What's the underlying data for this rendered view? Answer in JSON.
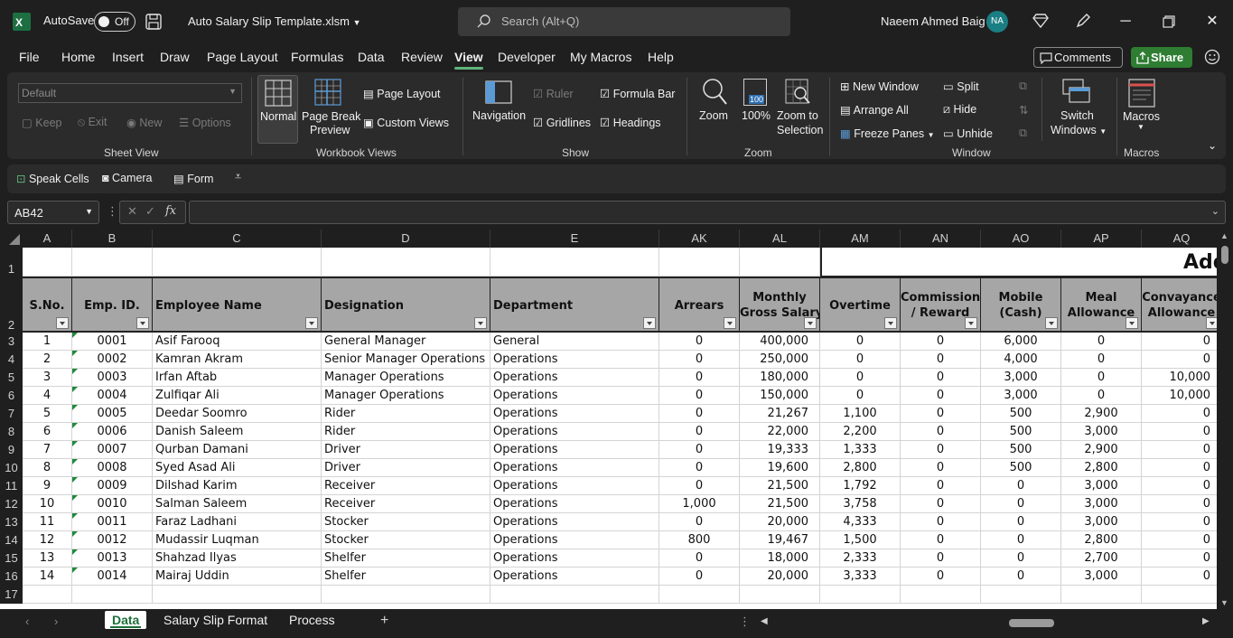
{
  "titlebar": {
    "autosave_label": "AutoSave",
    "autosave_state": "Off",
    "filename": "Auto Salary Slip Template.xlsm",
    "search_placeholder": "Search (Alt+Q)",
    "user_name": "Naeem Ahmed Baig",
    "user_initials": "NA"
  },
  "menu": {
    "items": [
      "File",
      "Home",
      "Insert",
      "Draw",
      "Page Layout",
      "Formulas",
      "Data",
      "Review",
      "View",
      "Developer",
      "My Macros",
      "Help"
    ],
    "active": "View",
    "comments_label": "Comments",
    "share_label": "Share"
  },
  "ribbon": {
    "sheet_view": {
      "dropdown_value": "Default",
      "keep": "Keep",
      "exit": "Exit",
      "new": "New",
      "options": "Options",
      "label": "Sheet View"
    },
    "workbook_views": {
      "normal": "Normal",
      "page_break_1": "Page Break",
      "page_break_2": "Preview",
      "page_layout": "Page Layout",
      "custom_views": "Custom Views",
      "label": "Workbook Views"
    },
    "show": {
      "navigation": "Navigation",
      "ruler": "Ruler",
      "gridlines": "Gridlines",
      "formula_bar": "Formula Bar",
      "headings": "Headings",
      "label": "Show"
    },
    "zoom": {
      "zoom": "Zoom",
      "hundred": "100%",
      "hundred_icon": "100",
      "zoom_sel_1": "Zoom to",
      "zoom_sel_2": "Selection",
      "label": "Zoom"
    },
    "window": {
      "new_window": "New Window",
      "arrange_all": "Arrange All",
      "freeze_panes": "Freeze Panes",
      "split": "Split",
      "hide": "Hide",
      "unhide": "Unhide",
      "switch_1": "Switch",
      "switch_2": "Windows",
      "label": "Window"
    },
    "macros": {
      "macros": "Macros",
      "label": "Macros"
    }
  },
  "qat": {
    "speak_cells": "Speak Cells",
    "camera": "Camera",
    "form": "Form"
  },
  "formula_bar": {
    "name_box": "AB42",
    "fx": "fx",
    "formula": ""
  },
  "sheet": {
    "columns": [
      "A",
      "B",
      "C",
      "D",
      "E",
      "AK",
      "AL",
      "AM",
      "AN",
      "AO",
      "AP",
      "AQ"
    ],
    "row1_title": "Add",
    "headers": [
      [
        "S.No."
      ],
      [
        "Emp. ID."
      ],
      [
        "Employee Name"
      ],
      [
        "Designation"
      ],
      [
        "Department"
      ],
      [
        "Arrears"
      ],
      [
        "Monthly",
        "Gross Salary"
      ],
      [
        "Overtime"
      ],
      [
        "Commission",
        "/ Reward"
      ],
      [
        "Mobile",
        "(Cash)"
      ],
      [
        "Meal",
        "Allowance"
      ],
      [
        "Convayance",
        "Allowance"
      ]
    ],
    "rows": [
      [
        "1",
        "0001",
        "Asif Farooq",
        "General Manager",
        "General",
        "0",
        "400,000",
        "0",
        "0",
        "6,000",
        "0",
        "0"
      ],
      [
        "2",
        "0002",
        "Kamran Akram",
        "Senior Manager Operations",
        "Operations",
        "0",
        "250,000",
        "0",
        "0",
        "4,000",
        "0",
        "0"
      ],
      [
        "3",
        "0003",
        "Irfan Aftab",
        "Manager Operations",
        "Operations",
        "0",
        "180,000",
        "0",
        "0",
        "3,000",
        "0",
        "10,000"
      ],
      [
        "4",
        "0004",
        "Zulfiqar Ali",
        "Manager Operations",
        "Operations",
        "0",
        "150,000",
        "0",
        "0",
        "3,000",
        "0",
        "10,000"
      ],
      [
        "5",
        "0005",
        "Deedar Soomro",
        "Rider",
        "Operations",
        "0",
        "21,267",
        "1,100",
        "0",
        "500",
        "2,900",
        "0"
      ],
      [
        "6",
        "0006",
        "Danish Saleem",
        "Rider",
        "Operations",
        "0",
        "22,000",
        "2,200",
        "0",
        "500",
        "3,000",
        "0"
      ],
      [
        "7",
        "0007",
        "Qurban Damani",
        "Driver",
        "Operations",
        "0",
        "19,333",
        "1,333",
        "0",
        "500",
        "2,900",
        "0"
      ],
      [
        "8",
        "0008",
        "Syed Asad Ali",
        "Driver",
        "Operations",
        "0",
        "19,600",
        "2,800",
        "0",
        "500",
        "2,800",
        "0"
      ],
      [
        "9",
        "0009",
        "Dilshad Karim",
        "Receiver",
        "Operations",
        "0",
        "21,500",
        "1,792",
        "0",
        "0",
        "3,000",
        "0"
      ],
      [
        "10",
        "0010",
        "Salman Saleem",
        "Receiver",
        "Operations",
        "1,000",
        "21,500",
        "3,758",
        "0",
        "0",
        "3,000",
        "0"
      ],
      [
        "11",
        "0011",
        "Faraz Ladhani",
        "Stocker",
        "Operations",
        "0",
        "20,000",
        "4,333",
        "0",
        "0",
        "3,000",
        "0"
      ],
      [
        "12",
        "0012",
        "Mudassir Luqman",
        "Stocker",
        "Operations",
        "800",
        "19,467",
        "1,500",
        "0",
        "0",
        "2,800",
        "0"
      ],
      [
        "13",
        "0013",
        "Shahzad Ilyas",
        "Shelfer",
        "Operations",
        "0",
        "18,000",
        "2,333",
        "0",
        "0",
        "2,700",
        "0"
      ],
      [
        "14",
        "0014",
        "Mairaj Uddin",
        "Shelfer",
        "Operations",
        "0",
        "20,000",
        "3,333",
        "0",
        "0",
        "3,000",
        "0"
      ]
    ],
    "row_numbers": [
      "1",
      "2",
      "3",
      "4",
      "5",
      "6",
      "7",
      "8",
      "9",
      "10",
      "11",
      "12",
      "13",
      "14",
      "15",
      "16",
      "17"
    ]
  },
  "tabs": {
    "items": [
      "Data",
      "Salary Slip Format",
      "Process"
    ],
    "active": "Data"
  }
}
